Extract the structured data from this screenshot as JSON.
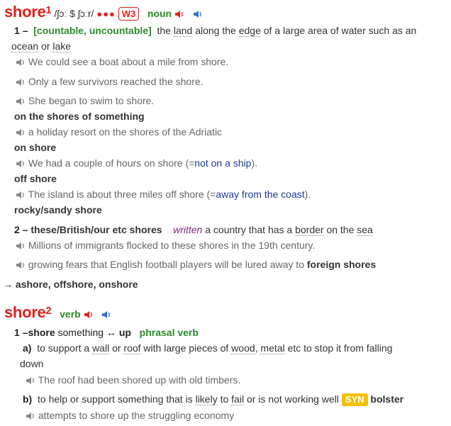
{
  "entry1": {
    "headword": "shore",
    "homnum": "1",
    "pron": "/ʃɔː $ ʃɔːr/",
    "dots": "●●●",
    "freq": "W3",
    "pos": "noun",
    "s1": {
      "num": "1",
      "dash": "–",
      "gram": "[countable, uncountable]",
      "def_a": "the ",
      "def_land": "land",
      "def_b": " along the ",
      "def_edge": "edge",
      "def_c": " of a large area of water such as an",
      "def_ocean": "ocean",
      "def_or": " or ",
      "def_lake": "lake",
      "ex1": "We could see a boat about a mile from shore.",
      "ex2": "Only a few survivors reached the shore.",
      "ex3": "She began to swim to shore.",
      "coll1": "on the shores of something",
      "ex4": "a holiday resort on the shores of the Adriatic",
      "coll2": "on shore",
      "ex5_a": "We had a couple of hours on shore (=",
      "ex5_g": "not on a ship",
      "ex5_b": ").",
      "coll3": "off shore",
      "ex6_a": "The island is about three miles off shore (=",
      "ex6_g": "away from the coast",
      "ex6_b": ").",
      "coll4": "rocky/sandy shore"
    },
    "s2": {
      "num": "2",
      "dash": "–",
      "lexunit": "these/British/our etc shores",
      "register": "written",
      "def_a": "a country that has a ",
      "def_border": "border",
      "def_b": " on the ",
      "def_sea": "sea",
      "ex1": "Millions of immigrants flocked to these shores in the 19th century.",
      "ex2_a": "growing fears that English football players will be lured away to ",
      "ex2_b": "foreign shores"
    },
    "xref": "→ ashore, offshore, onshore"
  },
  "entry2": {
    "headword": "shore",
    "homnum": "2",
    "pos": "verb",
    "s1": {
      "num": "1",
      "dash": "–",
      "pv_a": "shore",
      "pv_b": " something ",
      "pv_arrow": "↔",
      "pv_c": " up",
      "pv_label": "phrasal verb",
      "a_label": "a)",
      "a_def_a": "to support a ",
      "a_wall": "wall",
      "a_def_b": " or ",
      "a_roof": "roof",
      "a_def_c": " with large pieces of ",
      "a_wood": "wood",
      "a_def_d": ", ",
      "a_metal": "metal",
      "a_def_e": " etc to stop it from falling",
      "a_def_f": "down",
      "a_ex": "The roof had been shored up with old timbers.",
      "b_label": "b)",
      "b_def_a": "to help or support something that is ",
      "b_likely": "likely",
      "b_def_b": " to ",
      "b_fail": "fail",
      "b_def_c": " or is not working well",
      "syn_label": "SYN",
      "syn_word": "bolster",
      "b_ex": "attempts to shore up the struggling economy"
    }
  },
  "colors": {
    "headword": "#e0201b",
    "pos": "#2c8a2c",
    "gloss": "#1f3a93",
    "syn": "#f3c000"
  }
}
